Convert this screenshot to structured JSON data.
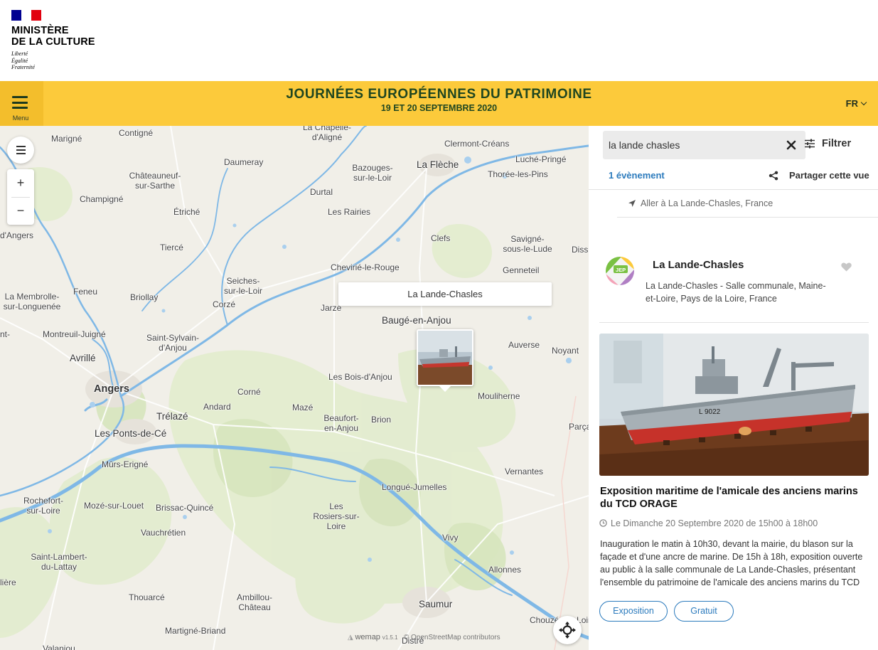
{
  "ministry": {
    "title_line1": "MINISTÈRE",
    "title_line2": "DE LA CULTURE",
    "motto": [
      "Liberté",
      "Égalité",
      "Fraternité"
    ]
  },
  "banner": {
    "menu_label": "Menu",
    "title": "JOURNÉES EUROPÉENNES DU PATRIMOINE",
    "dates": "19 ET 20 SEPTEMBRE 2020",
    "language": "FR",
    "accent_color": "#fcca3b"
  },
  "map": {
    "popup_label": "La Lande-Chasles",
    "attribution_brand": "wemap",
    "attribution_version": "v1.5.1",
    "attribution_osm": "© OpenStreetMap contributors",
    "places": [
      "Marigné",
      "Contigné",
      "La Chapelle-d'Aligné",
      "Daumeray",
      "Clermont-Créans",
      "Luché-Pringé",
      "Bazouges-sur-le-Loir",
      "La Flèche",
      "Thorée-les-Pins",
      "Châteauneuf-sur-Sarthe",
      "Durtal",
      "Champigné",
      "Étriché",
      "Les Rairies",
      "d'Angers",
      "Clefs",
      "Savigné-sous-le-Lude",
      "Diss",
      "Tiercé",
      "Chevirié-le-Rouge",
      "Genneteil",
      "Seiches-sur-le-Loir",
      "La Membrolle-sur-Longuenée",
      "Feneu",
      "Briollay",
      "Corzé",
      "Jarzé",
      "Baugé-en-Anjou",
      "Montreuil-Juigné",
      "Saint-Sylvain-d'Anjou",
      "Auverse",
      "Noyant",
      "Avrillé",
      "Les Bois-d'Anjou",
      "Angers",
      "Corné",
      "Mouliherne",
      "Andard",
      "Trélazé",
      "Mazé",
      "Beaufort-en-Anjou",
      "Brion",
      "Les Ponts-de-Cé",
      "Parça",
      "Mûrs-Erigné",
      "Vernantes",
      "Longué-Jumelles",
      "Rochefort-sur-Loire",
      "Mozé-sur-Louet",
      "Brissac-Quincé",
      "Les Rosiers-sur-Loire",
      "Vauchrétien",
      "Vivy",
      "Saint-Lambert-du-Lattay",
      "Allonnes",
      "lière",
      "Thouarcé",
      "Ambillou-Château",
      "Saumur",
      "Martigné-Briand",
      "Distré",
      "Chouzé-sur-Loire",
      "nt-",
      "Valanjou"
    ]
  },
  "search": {
    "value": "la lande chasles",
    "filter_label": "Filtrer",
    "result_count": "1 évènement",
    "share_label": "Partager cette vue",
    "goto_label": "Aller à La Lande-Chasles, France"
  },
  "location": {
    "name": "La Lande-Chasles",
    "address": "La Lande-Chasles - Salle communale, Maine-et-Loire, Pays de la Loire, France",
    "badge": "JEP"
  },
  "event": {
    "hull_number": "L 9022",
    "title": "Exposition maritime de l'amicale des anciens marins du TCD ORAGE",
    "date": "Le Dimanche 20 Septembre 2020 de 15h00 à 18h00",
    "description": "Inauguration le matin à 10h30, devant la mairie, du blason sur la façade et d'une ancre de marine. De 15h à 18h, exposition ouverte au public à la salle communale de La Lande-Chasles, présentant l'ensemble du patrimoine de l'amicale des anciens marins du TCD",
    "tags": [
      "Exposition",
      "Gratuit"
    ],
    "tag_color": "#2c7bbd"
  }
}
